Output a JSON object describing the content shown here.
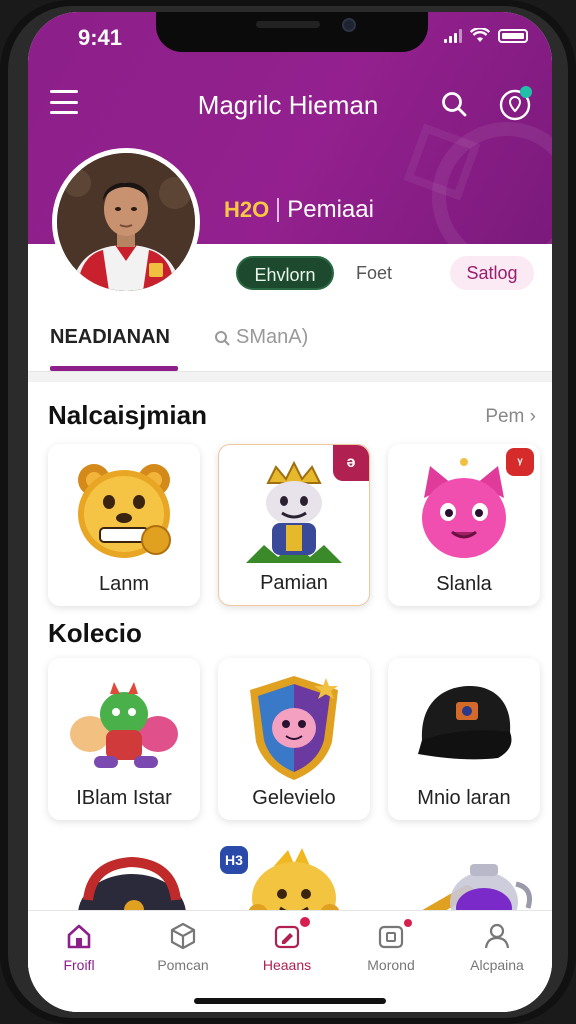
{
  "status": {
    "time": "9:41"
  },
  "header": {
    "title": "Magrilc Hieman"
  },
  "profile": {
    "team_logo": "H2O",
    "team_name": "Pemiaai"
  },
  "chips": {
    "active": "Ehvlorn",
    "plain": "Foet",
    "outline": "Satlog"
  },
  "tabs": {
    "first": "NEADIANAN",
    "second": "SManA)"
  },
  "section1": {
    "title": "Nalcaisjmian",
    "link": "Pem",
    "cards": [
      {
        "label": "Lanm",
        "icon": "bear-coin-icon"
      },
      {
        "label": "Pamian",
        "icon": "goblin-king-icon",
        "badge": "ǝ"
      },
      {
        "label": "Slanla",
        "icon": "pink-cat-icon",
        "badge": "ᵞ"
      }
    ]
  },
  "section2": {
    "title": "Kolecio",
    "cards": [
      {
        "label": "IBlam Istar",
        "icon": "monster-group-icon"
      },
      {
        "label": "Gelevielo",
        "icon": "shield-creature-icon"
      },
      {
        "label": "Mnio laran",
        "icon": "black-cap-icon"
      }
    ]
  },
  "section3": {
    "badge": "H3"
  },
  "bottom_nav": [
    {
      "label": "Froifl",
      "icon": "home-icon",
      "active": true
    },
    {
      "label": "Pomcan",
      "icon": "box-icon",
      "active": false
    },
    {
      "label": "Heaans",
      "icon": "edit-icon",
      "active": false
    },
    {
      "label": "Morond",
      "icon": "frame-icon",
      "active": false
    },
    {
      "label": "Alcpaina",
      "icon": "user-icon",
      "active": false
    }
  ],
  "colors": {
    "brand": "#8c1f8a",
    "chip_active": "#1d4a2f",
    "badge": "#b02050"
  }
}
